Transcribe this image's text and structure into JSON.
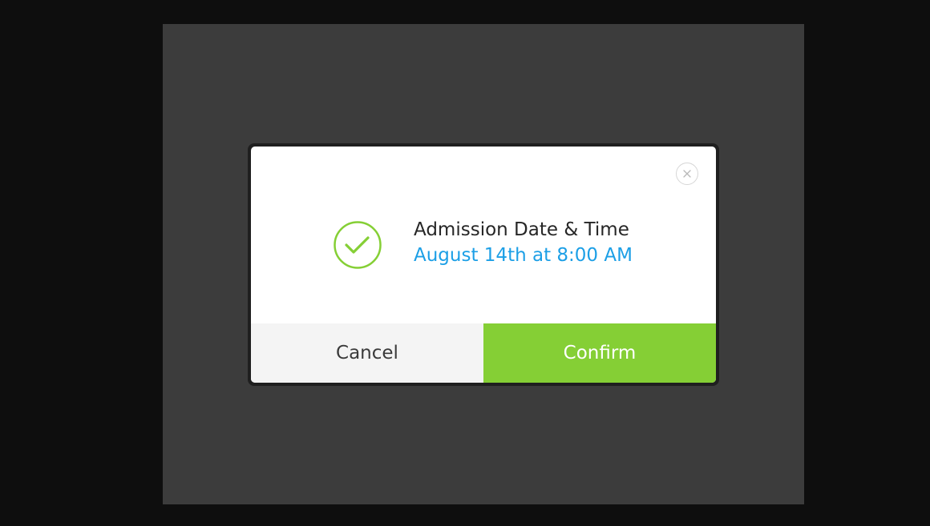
{
  "dialog": {
    "title": "Admission Date & Time",
    "value": "August 14th at 8:00 AM",
    "close_icon": "close-icon",
    "status_icon": "checkmark-circle-icon",
    "cancel_label": "Cancel",
    "confirm_label": "Confirm"
  },
  "colors": {
    "accent_green": "#85cf35",
    "value_blue": "#1c9fe6",
    "overlay": "#3c3c3c",
    "background": "#0e0e0e"
  }
}
